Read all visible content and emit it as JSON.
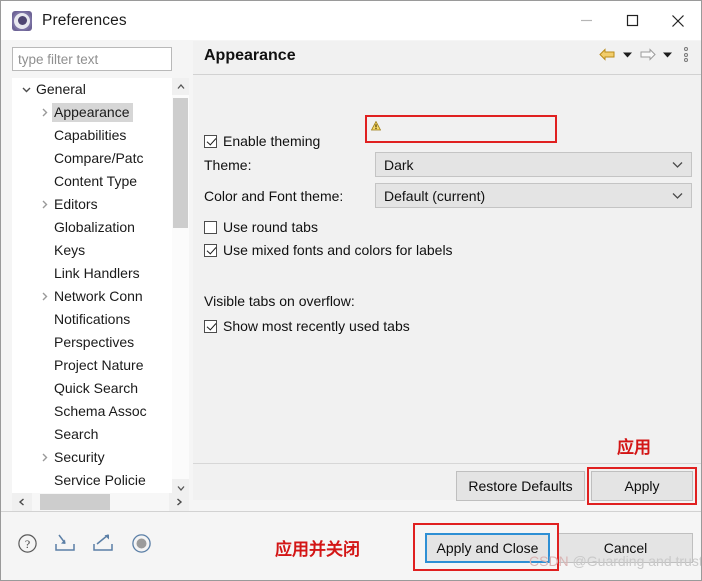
{
  "window": {
    "title": "Preferences",
    "icon": "gear-icon",
    "controls": {
      "minimize": "minimize-icon",
      "maximize": "maximize-icon",
      "close": "close-icon"
    }
  },
  "sidebar": {
    "filter_placeholder": "type filter text",
    "filter_value": "",
    "items": [
      {
        "label": "General",
        "level": 1,
        "arrow": "down",
        "selected": false
      },
      {
        "label": "Appearance",
        "level": 2,
        "arrow": "right",
        "selected": true
      },
      {
        "label": "Capabilities",
        "level": 2,
        "arrow": "none",
        "selected": false
      },
      {
        "label": "Compare/Patc",
        "level": 2,
        "arrow": "none",
        "selected": false
      },
      {
        "label": "Content Type",
        "level": 2,
        "arrow": "none",
        "selected": false
      },
      {
        "label": "Editors",
        "level": 2,
        "arrow": "right",
        "selected": false
      },
      {
        "label": "Globalization",
        "level": 2,
        "arrow": "none",
        "selected": false
      },
      {
        "label": "Keys",
        "level": 2,
        "arrow": "none",
        "selected": false
      },
      {
        "label": "Link Handlers",
        "level": 2,
        "arrow": "none",
        "selected": false
      },
      {
        "label": "Network Conn",
        "level": 2,
        "arrow": "right",
        "selected": false
      },
      {
        "label": "Notifications",
        "level": 2,
        "arrow": "none",
        "selected": false
      },
      {
        "label": "Perspectives",
        "level": 2,
        "arrow": "none",
        "selected": false
      },
      {
        "label": "Project Nature",
        "level": 2,
        "arrow": "none",
        "selected": false
      },
      {
        "label": "Quick Search",
        "level": 2,
        "arrow": "none",
        "selected": false
      },
      {
        "label": "Schema Assoc",
        "level": 2,
        "arrow": "none",
        "selected": false
      },
      {
        "label": "Search",
        "level": 2,
        "arrow": "none",
        "selected": false
      },
      {
        "label": "Security",
        "level": 2,
        "arrow": "right",
        "selected": false
      },
      {
        "label": "Service Policie",
        "level": 2,
        "arrow": "none",
        "selected": false
      }
    ]
  },
  "panel": {
    "title": "Appearance",
    "toolbar": {
      "back": "back-arrow-icon",
      "back_menu": "chevron-down-icon",
      "forward": "forward-arrow-icon",
      "forward_menu": "chevron-down-icon",
      "more": "view-menu-icon"
    },
    "enable_theming": {
      "label": "Enable theming",
      "checked": true
    },
    "theme": {
      "label": "Theme:",
      "value": "Dark",
      "warning": "warning-icon"
    },
    "color_font_theme": {
      "label": "Color and Font theme:",
      "value": "Default (current)"
    },
    "round_tabs": {
      "label": "Use round tabs",
      "checked": false
    },
    "mixed_fonts": {
      "label": "Use mixed fonts and colors for labels",
      "checked": true
    },
    "visible_tabs_label": "Visible tabs on overflow:",
    "mru_tabs": {
      "label": "Show most recently used tabs",
      "checked": true
    }
  },
  "buttons": {
    "restore_defaults": "Restore Defaults",
    "apply": "Apply",
    "apply_and_close": "Apply and Close",
    "cancel": "Cancel"
  },
  "bottom_icons": [
    {
      "name": "help-icon"
    },
    {
      "name": "import-icon"
    },
    {
      "name": "export-icon"
    },
    {
      "name": "settings-circle-icon"
    }
  ],
  "annotations": {
    "apply_label": "应用",
    "apply_and_close_label": "应用并关闭",
    "box_color": "#e02020",
    "focus_color": "#2e8fd4"
  },
  "watermark": {
    "prefix": "CSDN",
    "text": " @Guarding and trust"
  }
}
